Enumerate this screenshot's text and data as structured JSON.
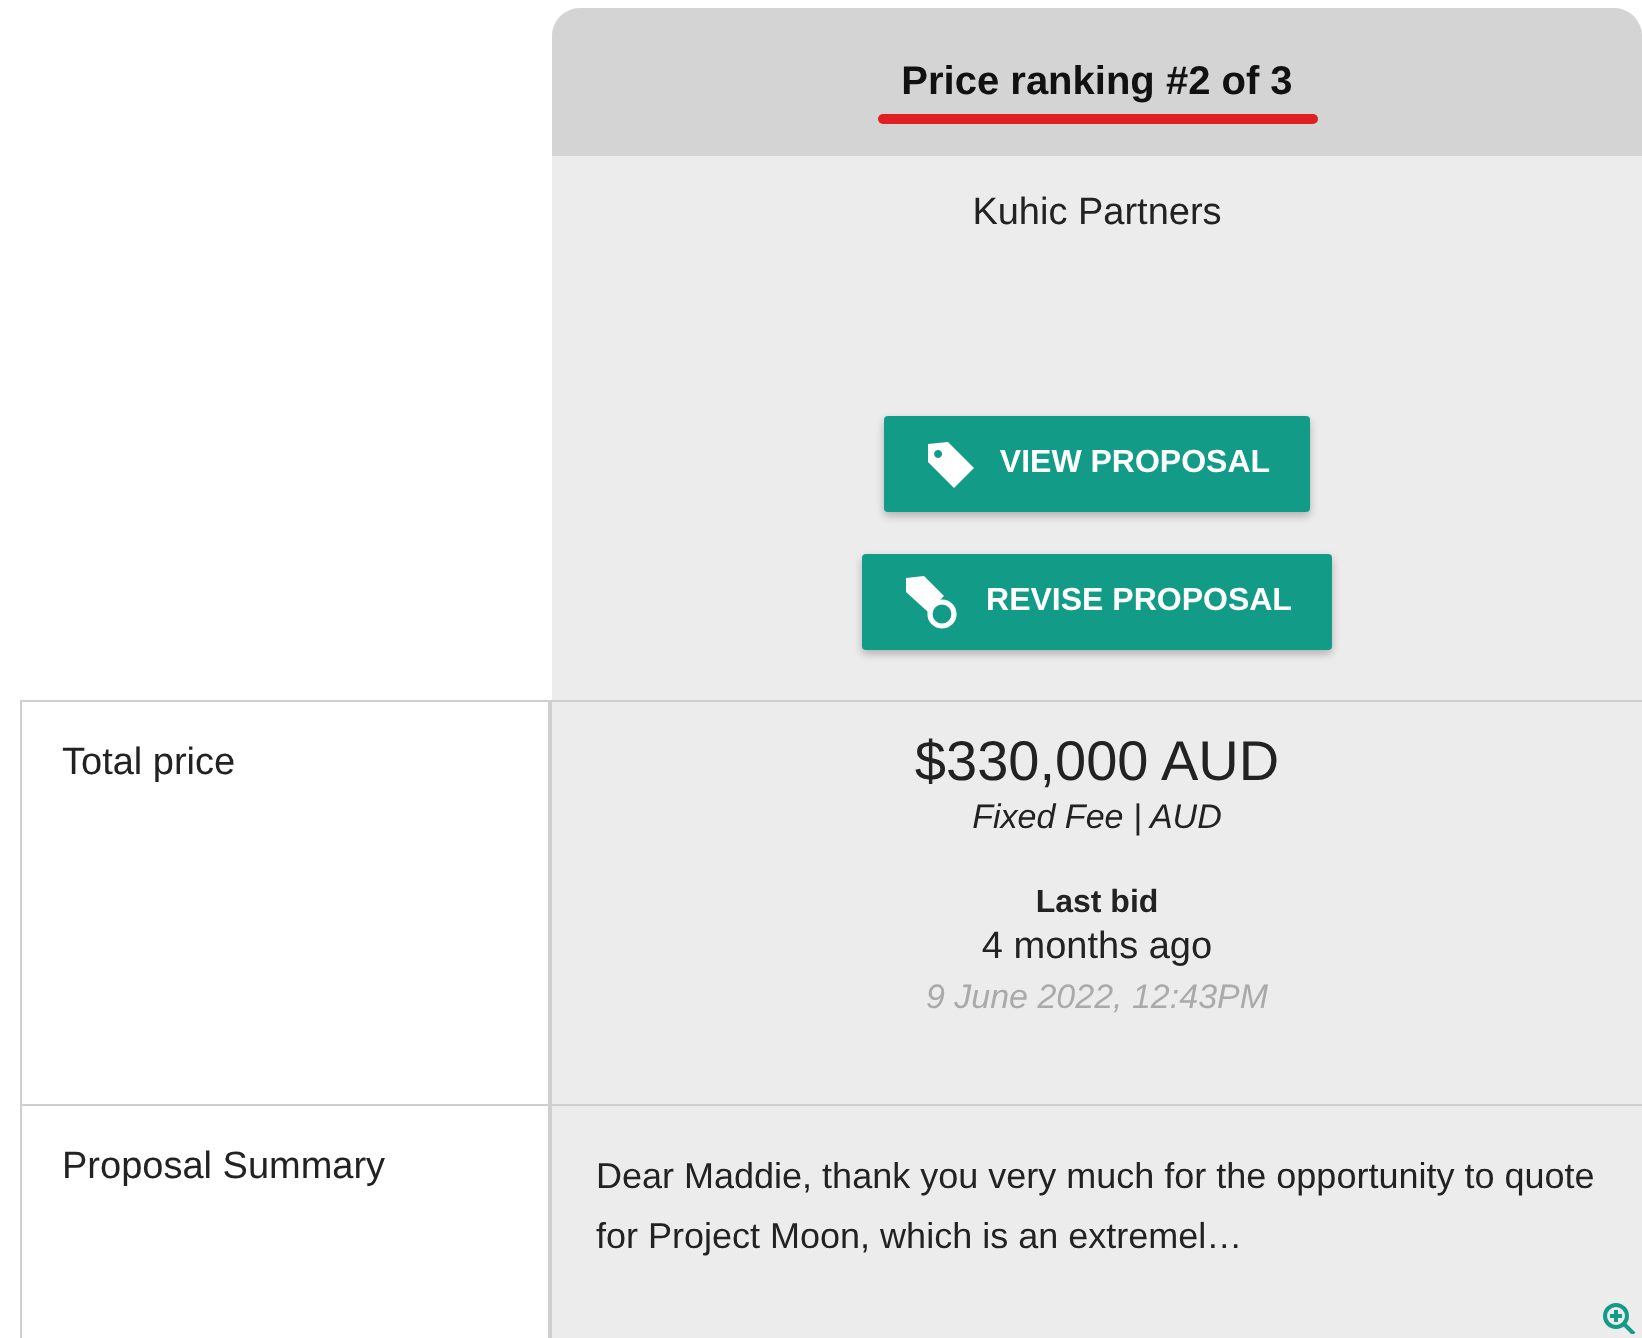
{
  "header": {
    "title": "Price ranking #2 of 3",
    "underlined": true
  },
  "supplier": {
    "name": "Kuhic Partners"
  },
  "buttons": [
    {
      "kind": "view",
      "label": "VIEW PROPOSAL"
    },
    {
      "kind": "revise",
      "label": "REVISE PROPOSAL"
    }
  ],
  "rows": [
    {
      "kind": "price",
      "label": "Total price",
      "price": "$330,000 AUD",
      "fee": "Fixed Fee | AUD",
      "bid_label": "Last bid",
      "bid_ago": "4 months ago",
      "bid_date": "9 June 2022, 12:43PM"
    },
    {
      "kind": "summary",
      "label": "Proposal Summary",
      "text": "Dear Maddie, thank you very much for the opportunity to quote for Project Moon, which is an extremel…"
    }
  ]
}
